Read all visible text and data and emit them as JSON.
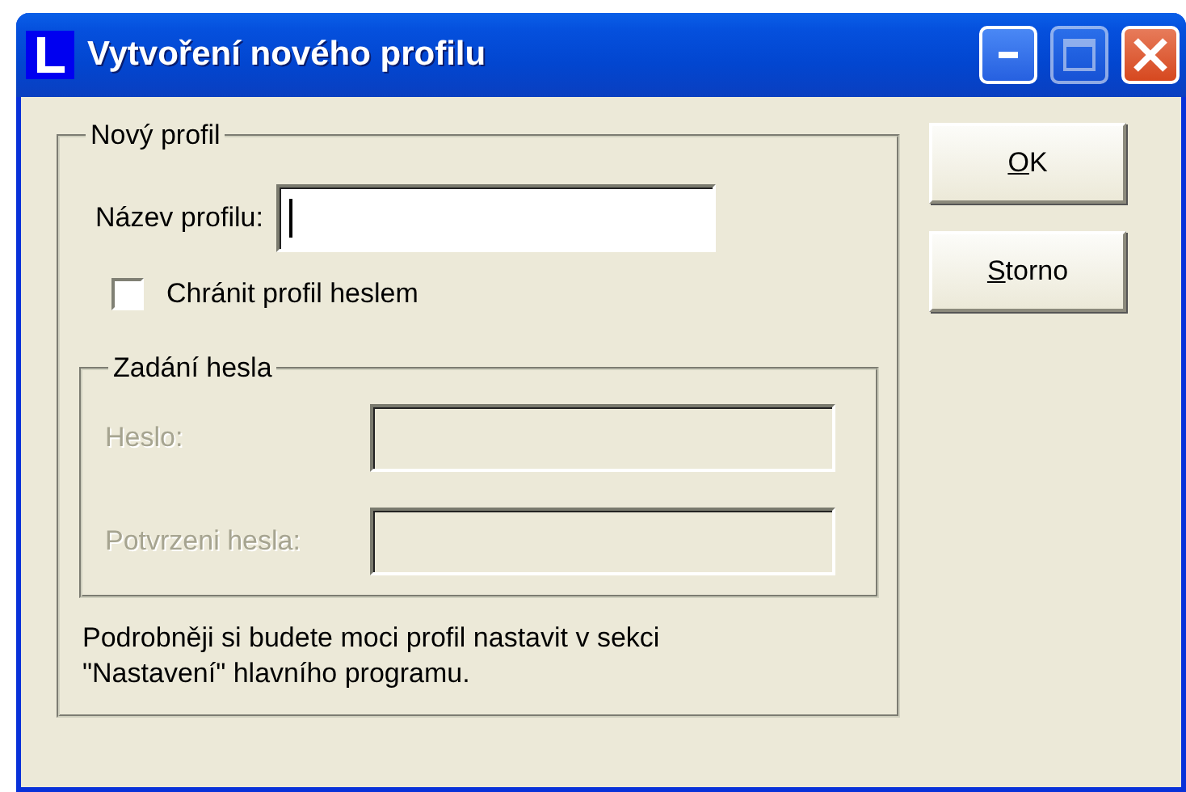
{
  "window": {
    "title": "Vytvoření nového profilu",
    "controls": [
      {
        "kind": "minimize",
        "disabled": false
      },
      {
        "kind": "maximize",
        "disabled": true
      },
      {
        "kind": "close",
        "disabled": false
      }
    ]
  },
  "profile_group": {
    "title": "Nový profil",
    "name_label": "Název profilu:",
    "name_focused": true,
    "protect": {
      "label": "Chránit profil heslem",
      "checked": false
    },
    "password_group": {
      "title": "Zadání hesla",
      "disabled": true,
      "fields": [
        {
          "label": "Heslo:"
        },
        {
          "label": "Potvrzeni hesla:"
        }
      ]
    },
    "note": "Podrobněji si budete moci profil nastavit v sekci \"Nastavení\" hlavního programu."
  },
  "buttons": [
    {
      "access_key": "O",
      "rest": "K"
    },
    {
      "access_key": "S",
      "rest": "torno"
    }
  ]
}
